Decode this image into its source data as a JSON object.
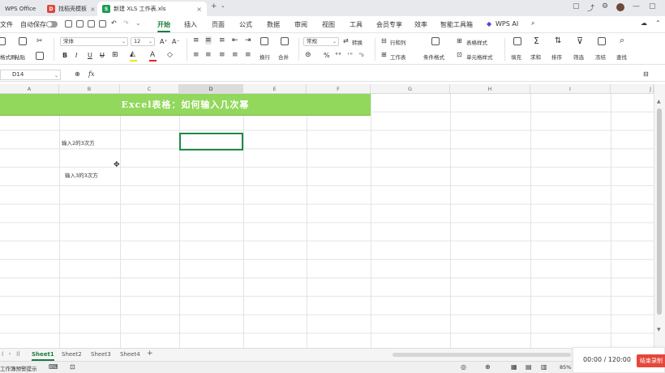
{
  "tabs": [
    {
      "label": "WPS Office"
    },
    {
      "label": "找稻壳模板",
      "badge": "D"
    },
    {
      "label": "新建 XLS 工作表.xls",
      "badge": "S"
    }
  ],
  "menu": {
    "file": "文件",
    "autosave": "自动保存",
    "items": [
      "开始",
      "插入",
      "页面",
      "公式",
      "数据",
      "审阅",
      "视图",
      "工具",
      "会员专享",
      "效率",
      "智能工具箱"
    ],
    "active": "开始",
    "wps_ai": "WPS AI"
  },
  "ribbon": {
    "format_painter": "格式刷",
    "paste": "粘贴",
    "font_name": "宋体",
    "font_size": "12",
    "wrap": "换行",
    "merge": "合并",
    "number_format": "常规",
    "convert": "转换",
    "row_col": "行和列",
    "worksheet": "工作表",
    "conditional_format": "条件格式",
    "table_style": "表格样式",
    "cell_style": "单元格样式",
    "fill": "填充",
    "sum": "求和",
    "sort": "排序",
    "filter": "筛选",
    "freeze": "冻结",
    "find": "查找"
  },
  "formula_bar": {
    "cell_ref": "D14",
    "fx": "fx",
    "value": ""
  },
  "columns": [
    "A",
    "B",
    "C",
    "D",
    "E",
    "F",
    "G",
    "H",
    "I",
    "J"
  ],
  "selected_column": "D",
  "sheet": {
    "banner_title": "Excel表格：如何输入几次幂",
    "cells": [
      {
        "text": "输入2的3次方"
      },
      {
        "text": "输入3的3次方"
      }
    ]
  },
  "sheets": [
    "Sheet1",
    "Sheet2",
    "Sheet3",
    "Sheet4"
  ],
  "active_sheet": "Sheet1",
  "status": {
    "left": "工作簿预警提示",
    "zoom": "85%"
  },
  "recorder": {
    "time": "00:00 / 120:00",
    "button": "结束录制"
  },
  "colors": {
    "accent": "#1b7d3c",
    "banner": "#92d85c",
    "record": "#e6473a"
  }
}
